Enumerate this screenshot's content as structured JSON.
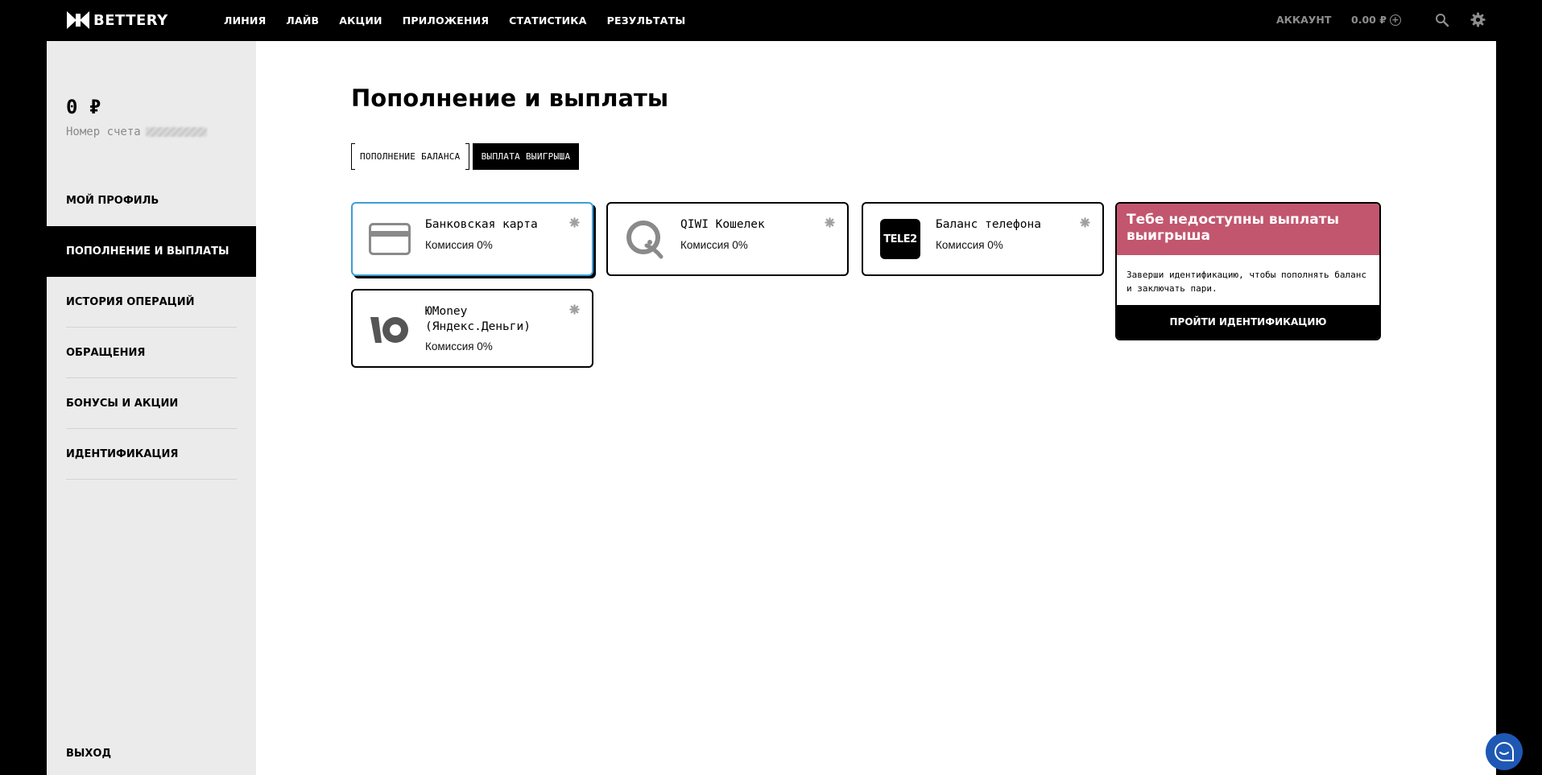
{
  "header": {
    "logo_text": "BETTERY",
    "nav": [
      "ЛИНИЯ",
      "ЛАЙВ",
      "АКЦИИ",
      "ПРИЛОЖЕНИЯ",
      "СТАТИСТИКА",
      "РЕЗУЛЬТАТЫ"
    ],
    "account_label": "АККАУНТ",
    "balance": "0.00 ₽",
    "icons": [
      "plus-circle-icon",
      "search-icon",
      "gear-icon"
    ]
  },
  "sidebar": {
    "balance": "0 ₽",
    "account_label": "Номер счета",
    "menu": [
      {
        "label": "МОЙ ПРОФИЛЬ",
        "active": false
      },
      {
        "label": "ПОПОЛНЕНИЕ И ВЫПЛАТЫ",
        "active": true
      },
      {
        "label": "ИСТОРИЯ ОПЕРАЦИЙ",
        "active": false
      },
      {
        "label": "ОБРАЩЕНИЯ",
        "active": false
      },
      {
        "label": "БОНУСЫ И АКЦИИ",
        "active": false
      },
      {
        "label": "ИДЕНТИФИКАЦИЯ",
        "active": false
      }
    ],
    "logout": "ВЫХОД"
  },
  "main": {
    "title": "Пополнение и выплаты",
    "tabs": [
      {
        "label": "ПОПОЛНЕНИЕ БАЛАНСА",
        "active": false
      },
      {
        "label": "ВЫПЛАТА ВЫИГРЫША",
        "active": true
      }
    ],
    "methods": [
      {
        "name": "Банковская карта",
        "fee": "Комиссия 0%",
        "icon": "card-icon",
        "selected": true
      },
      {
        "name": "QIWI Кошелек",
        "fee": "Комиссия 0%",
        "icon": "qiwi-icon",
        "selected": false
      },
      {
        "name": "Баланс телефона",
        "fee": "Комиссия 0%",
        "icon": "tele2-icon",
        "icon_text": "TELE2",
        "selected": false
      },
      {
        "name": "ЮMoney (Яндекс.Деньги)",
        "fee": "Комиссия 0%",
        "icon": "yumoney-icon",
        "selected": false
      }
    ],
    "notice": {
      "title": "Тебе недоступны выплаты выигрыша",
      "text": "Заверши идентификацию, чтобы пополнять баланс и заключать пари.",
      "button": "ПРОЙТИ ИДЕНТИФИКАЦИЮ"
    }
  },
  "colors": {
    "accent_pink": "#c2566e",
    "selected_border": "#3a9fd8",
    "chat_blue": "#1e58b5",
    "sidebar_bg": "#ebebeb"
  }
}
